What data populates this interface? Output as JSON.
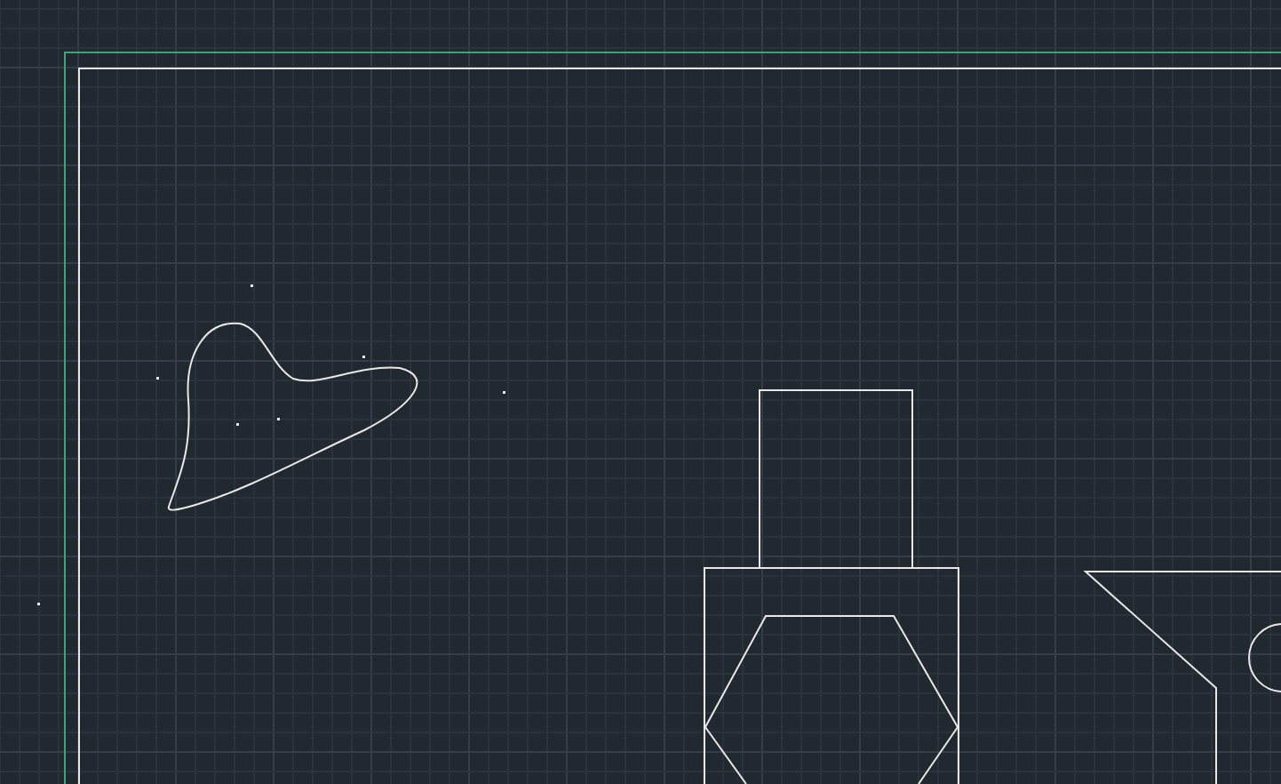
{
  "canvas": {
    "kind": "cad"
  }
}
